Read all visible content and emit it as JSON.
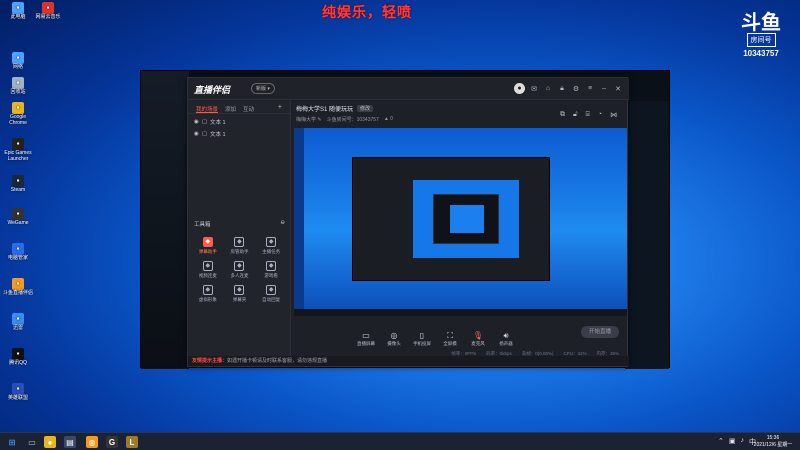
{
  "overlay": {
    "top_caption": "纯娱乐，轻喷",
    "brand_mark": "斗鱼",
    "brand_sub": "房间号",
    "room_number": "10343757"
  },
  "desktop_icons": [
    {
      "label": "此电脑",
      "icon": "computer-icon",
      "color": "#4aa3ff"
    },
    {
      "label": "网易云音乐",
      "icon": "music-icon",
      "color": "#e0322c"
    },
    {
      "label": "网络",
      "icon": "network-icon",
      "color": "#4aa3ff"
    },
    {
      "label": "回收站",
      "icon": "recycle-bin-icon",
      "color": "#9fb3c8"
    },
    {
      "label": "Google Chrome",
      "icon": "chrome-icon",
      "color": "#e8b51f"
    },
    {
      "label": "Epic Games Launcher",
      "icon": "epic-icon",
      "color": "#222"
    },
    {
      "label": "Steam",
      "icon": "steam-icon",
      "color": "#1b2838"
    },
    {
      "label": "WeGame",
      "icon": "wegame-icon",
      "color": "#333"
    },
    {
      "label": "电脑管家",
      "icon": "shield-icon",
      "color": "#2a6cf0"
    },
    {
      "label": "斗鱼直播伴侣",
      "icon": "douyu-icon",
      "color": "#f39a1f"
    },
    {
      "label": "迅雷",
      "icon": "thunder-icon",
      "color": "#3a8cf5"
    },
    {
      "label": "腾讯QQ",
      "icon": "qq-icon",
      "color": "#111"
    },
    {
      "label": "英雄联盟",
      "icon": "lol-icon",
      "color": "#2a4cc0"
    }
  ],
  "app": {
    "title": "直播伴侣",
    "version_badge": "新版 ▾",
    "tabs": [
      "我的场景",
      "添加",
      "互动"
    ],
    "scenes": [
      {
        "label": "文本 1"
      },
      {
        "label": "文本 1"
      }
    ],
    "toolbox_title": "工具箱",
    "tools": [
      {
        "label": "弹幕助手",
        "icon": "chat-icon",
        "hot": true
      },
      {
        "label": "房管助手",
        "icon": "user-icon",
        "hot": false
      },
      {
        "label": "主播任务",
        "icon": "task-icon",
        "hot": false
      },
      {
        "label": "视频连麦",
        "icon": "video-icon",
        "hot": false
      },
      {
        "label": "多人连麦",
        "icon": "group-icon",
        "hot": false
      },
      {
        "label": "游戏看",
        "icon": "game-icon",
        "hot": false
      },
      {
        "label": "虚拟形象",
        "icon": "avatar-icon",
        "hot": false
      },
      {
        "label": "弹幕夹",
        "icon": "calendar-icon",
        "hot": false
      },
      {
        "label": "自动回复",
        "icon": "reply-icon",
        "hot": false
      }
    ],
    "room_title": "梅梅大学S1 随便玩玩",
    "room_badge": "修改",
    "room_meta": [
      "梅梅大学 ✎",
      "斗鱼房间号：10343757",
      "▲ 0"
    ],
    "bottom_tools": [
      {
        "label": "直播屏幕",
        "icon": "screen-icon"
      },
      {
        "label": "摄像头",
        "icon": "camera-icon"
      },
      {
        "label": "手机投屏",
        "icon": "phone-icon"
      },
      {
        "label": "全屏模",
        "icon": "fullscreen-icon"
      },
      {
        "label": "麦克风",
        "icon": "mic-icon"
      },
      {
        "label": "扬声器",
        "icon": "speaker-icon"
      }
    ],
    "start_button": "开始直播",
    "status": [
      "帧率：0FPS",
      "码率：0kbps",
      "丢帧：0(0.00%)",
      "CPU：42%",
      "内存：35%"
    ],
    "notice_highlight": "友情提示主播：",
    "notice_text": "如遇开播卡顿请及时联系客服，请勿违规直播"
  },
  "taskbar": {
    "time": "15:36",
    "date": "2021/12/6 星期一",
    "lang": "中"
  }
}
